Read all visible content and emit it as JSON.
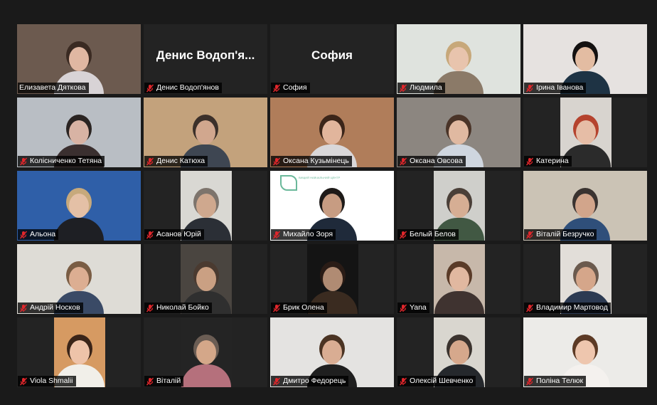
{
  "participants": [
    {
      "name": "Елизавета Дяткова",
      "muted": false,
      "active": true,
      "video": true,
      "bg": "#2d2d2d",
      "scene": "#6c5a4f",
      "skin": "#e0b7a2",
      "hair": "#3a2a22",
      "shirt": "#d8d3d6"
    },
    {
      "name": "Денис Водоп'янов",
      "display": "Денис Водоп'я...",
      "muted": true,
      "video": false
    },
    {
      "name": "София",
      "display": "София",
      "muted": true,
      "video": false
    },
    {
      "name": "Людмила",
      "muted": true,
      "video": true,
      "bg": "#e8ebe6",
      "scene": "#dfe3de",
      "skin": "#e8c4ad",
      "hair": "#c7a87a",
      "shirt": "#8b7a68"
    },
    {
      "name": "Ірина Іванова",
      "muted": true,
      "video": true,
      "bg": "#ece8e6",
      "scene": "#e6e2e0",
      "skin": "#e3bca2",
      "hair": "#141111",
      "shirt": "#1e3344"
    },
    {
      "name": "Колісниченко Тетяна",
      "muted": true,
      "video": true,
      "bg": "#c9cdd1",
      "scene": "#b9bec4",
      "skin": "#d8b3a4",
      "hair": "#2a2422",
      "shirt": "#3a2f2f"
    },
    {
      "name": "Денис Катюха",
      "muted": true,
      "video": true,
      "bg": "#cfcac2",
      "scene": "#c3a27c",
      "skin": "#d1a78e",
      "hair": "#3b302a",
      "shirt": "#3e4652"
    },
    {
      "name": "Оксана Кузьмінець",
      "muted": true,
      "video": true,
      "bg": "#8ea7a3",
      "scene": "#b07d5a",
      "skin": "#e1b59c",
      "hair": "#3b2519",
      "shirt": "#d9d7d9"
    },
    {
      "name": "Оксана Овсова",
      "muted": true,
      "video": true,
      "bg": "#6f6a66",
      "scene": "#8c8680",
      "skin": "#e0b9a1",
      "hair": "#4a3428",
      "shirt": "#cfd6df"
    },
    {
      "name": "Катерина",
      "muted": true,
      "video": true,
      "bg": "#232323",
      "scene": "#d8d4cf",
      "skin": "#e6bda6",
      "hair": "#b5432e",
      "shirt": "#2b2b2b",
      "narrow": true
    },
    {
      "name": "Альона",
      "muted": true,
      "video": true,
      "bg": "#c6b79c",
      "scene": "#2f5fa8",
      "skin": "#e4c0a6",
      "hair": "#c7a97c",
      "shirt": "#1e1f24"
    },
    {
      "name": "Асанов Юрій",
      "muted": true,
      "video": true,
      "bg": "#232323",
      "scene": "#d9d8d3",
      "skin": "#cfa88e",
      "hair": "#7d746c",
      "shirt": "#2b2f36",
      "narrow": true
    },
    {
      "name": "Михайло Зоря",
      "muted": true,
      "video": true,
      "bg": "#ffffff",
      "scene": "#ffffff",
      "skin": "#c79c82",
      "hair": "#1e1a18",
      "shirt": "#1f2a3a",
      "logo": "ВИЩИЙ НАВЧАЛЬНИЙ ЦЕНТР"
    },
    {
      "name": "Белый Белов",
      "muted": true,
      "video": true,
      "bg": "#232323",
      "scene": "#cfcfcb",
      "skin": "#d6ae94",
      "hair": "#4a3f38",
      "shirt": "#415843",
      "narrow": true
    },
    {
      "name": "Віталій Безручко",
      "muted": true,
      "video": true,
      "bg": "#d6cfc3",
      "scene": "#cbc3b5",
      "skin": "#d2a58b",
      "hair": "#3a3330",
      "shirt": "#2f4f7a"
    },
    {
      "name": "Андрій Носков",
      "muted": true,
      "video": true,
      "bg": "#e7e6e2",
      "scene": "#dedcd6",
      "skin": "#dcae92",
      "hair": "#7a5d44",
      "shirt": "#3a4a66"
    },
    {
      "name": "Николай Бойко",
      "muted": true,
      "video": true,
      "bg": "#232323",
      "scene": "#4a4540",
      "skin": "#caa083",
      "hair": "#4a3a30",
      "shirt": "#2f2f2f",
      "narrow": true
    },
    {
      "name": "Брик Олена",
      "muted": true,
      "video": true,
      "bg": "#232323",
      "scene": "#141414",
      "skin": "#b08b73",
      "hair": "#2a1c16",
      "shirt": "#3a2b20",
      "narrow": true
    },
    {
      "name": "Yana",
      "muted": true,
      "video": true,
      "bg": "#232323",
      "scene": "#c7b8aa",
      "skin": "#e1b8a0",
      "hair": "#5a3b28",
      "shirt": "#3f3330",
      "narrow": true
    },
    {
      "name": "Владимир Мартовод",
      "muted": true,
      "video": true,
      "bg": "#232323",
      "scene": "#e2ded9",
      "skin": "#d5a68a",
      "hair": "#6b5a4e",
      "shirt": "#2c3a52",
      "narrow": true
    },
    {
      "name": "Viola Shmalii",
      "muted": true,
      "video": true,
      "bg": "#232323",
      "scene": "#d69a62",
      "skin": "#eec3a9",
      "hair": "#3a2418",
      "shirt": "#f1efe9",
      "narrow": true
    },
    {
      "name": "Віталій",
      "muted": true,
      "video": true,
      "bg": "#232323",
      "scene": "#242424",
      "skin": "#d4a789",
      "hair": "#6b5d54",
      "shirt": "#b5707c",
      "narrow": true
    },
    {
      "name": "Дмитро Федорець",
      "muted": true,
      "video": true,
      "bg": "#e9e8e6",
      "scene": "#e4e3e1",
      "skin": "#d9ad93",
      "hair": "#4a3323",
      "shirt": "#1f1f1f"
    },
    {
      "name": "Олексій Шевченко",
      "muted": true,
      "video": true,
      "bg": "#232323",
      "scene": "#d9d6cf",
      "skin": "#d6a88c",
      "hair": "#3b332e",
      "shirt": "#25282c",
      "narrow": true
    },
    {
      "name": "Поліна Телюк",
      "muted": true,
      "video": true,
      "bg": "#f1f1f0",
      "scene": "#ecebe8",
      "skin": "#eec6ae",
      "hair": "#5c3a25",
      "shirt": "#f4f1ee"
    }
  ],
  "colors": {
    "active_border": "#c9e35a",
    "muted_icon": "#e0262b",
    "tile_bg": "#232323",
    "page_bg": "#1a1a1a"
  }
}
